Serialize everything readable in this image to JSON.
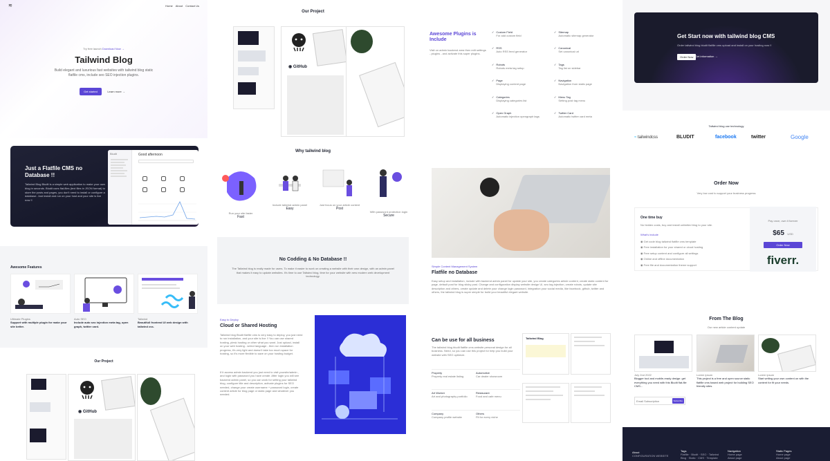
{
  "p1": {
    "nav": [
      "Home",
      "About",
      "Contact Us"
    ],
    "tagline_left": "Try free launch",
    "tagline_btn": "Download Now →",
    "title": "Tailwind Blog",
    "desc": "Build elegant and luxurious fast websites with tailwind blog static flatfile cms, include seo SEO injection plugins.",
    "cta_primary": "Get started",
    "cta_secondary": "Learn more →"
  },
  "p2": {
    "heading": "Just a Flatfile CMS no Database !!",
    "desc": "Tailwind Blog Bludit is a simple web application to make your own blog in seconds. Bludit uses flat-files (text files in JSON format) to store the posts and pages, you don't need to install or configure a database. Just install and run on your host and your site is live now !!",
    "dash_title": "Bludit",
    "dash_greet": "Good afternoon"
  },
  "p3": {
    "heading": "Awesome Features",
    "cards": [
      {
        "tag": "Ultimate Plugins",
        "text": "Support with multiple plugin for make your site better."
      },
      {
        "tag": "Auto SEO",
        "text": "Include auto seo injection meta tag, open graph, twitter card."
      },
      {
        "tag": "Tailwind",
        "text": "Beautifull frontend UI web design with tailwind css."
      }
    ]
  },
  "p4": {
    "heading": "Our Project"
  },
  "p5": {
    "heading": "Our Project",
    "github_label": "GitHub"
  },
  "p6": {
    "heading": "Why tailwind blog",
    "items": [
      {
        "small": "Run your site faster",
        "big": "Fast"
      },
      {
        "small": "Include tailwind admin panel",
        "big": "Easy"
      },
      {
        "small": "Just focus on your article content",
        "big": "Post"
      },
      {
        "small": "With password protection login",
        "big": "Secure"
      }
    ]
  },
  "p7": {
    "heading": "No Codding & No Database !!",
    "desc": "The Tailwind blog is really made for users. To make it easier to work on creating a website with their own design, with an admin panel that makes it easy to update websites. It's time to use Tailwind blog, time for your website with new modern web development technology."
  },
  "p8": {
    "tag": "Easy to Deploy",
    "heading": "Cloud or Shared Hosting",
    "desc1": "Tailwind blog Bludit flatfile cms is very easy to deploy, you just need to run installation, and your site is live !! You can use shared hosting, plesk hosting or other what you want. Just upload, install on your web hosting - select language - then run installation progress, it's very light and doesn't take too much space for hosting, so it's more flexible to save on your hosting budget.",
    "desc2": "If it access admin backend you just need to visit yoursite/admin , and login with password you have create. After login you will see backend admin panel, so you can work for setting your tailwind blog, configure title and description, activate plugins for SEO needed, change your create username + password login, create content article for blog page or static page and whatever you needed."
  },
  "p9": {
    "heading": "Awesome Plugins is Include",
    "desc": "Visit on admin backend area then edit settings - plugins - and activate this super plugins.",
    "plugins": [
      {
        "name": "Custom Field",
        "desc": "For add custom field"
      },
      {
        "name": "Sitemap",
        "desc": "Automatic sitemap generator"
      },
      {
        "name": "RSS",
        "desc": "Auto RSS feed generator"
      },
      {
        "name": "Canonical",
        "desc": "Set canonical url"
      },
      {
        "name": "Robots",
        "desc": "Robots meta tag setup"
      },
      {
        "name": "Tags",
        "desc": "Tag list on sidebar"
      },
      {
        "name": "Page",
        "desc": "Displaying content page"
      },
      {
        "name": "Navigation",
        "desc": "Navigation from static page"
      },
      {
        "name": "Categories",
        "desc": "Displaying categories list"
      },
      {
        "name": "Menu Tag",
        "desc": "Setting post tag menu"
      },
      {
        "name": "Open Graph",
        "desc": "Automatic injection opengraph tags"
      },
      {
        "name": "Twitter Card",
        "desc": "Automatic twitter card meta"
      }
    ]
  },
  "p10": {
    "tag": "Simple Content Management System",
    "heading": "Flatfile no Database",
    "desc": "Easy setup and installation, include with backend admin panel for update your site, you create categories article content, create static content for page, default post for blog sticky post. Change and configuration display website design UI, seo tag injection, create robots, update site description and others, create update and delete your change login password, integration your social media, like facebook, github, twitter and others, the tailwind blog is super simple for build your beautiful elegant website."
  },
  "p11": {
    "heading": "Can be use for all business",
    "desc": "The tailwind blog bludit flatfile cms website personal design for all business. Need, so you can use this project for help you build your website with SEO optimize.",
    "items": [
      {
        "name": "Property",
        "desc": "Property real estate listing"
      },
      {
        "name": "Automotive",
        "desc": "Car dealer showroom"
      },
      {
        "name": "Art Worker",
        "desc": "Art and photography portfolio"
      },
      {
        "name": "Restaurant",
        "desc": "Food and cafe menu"
      },
      {
        "name": "Company",
        "desc": "Company profile website"
      },
      {
        "name": "Others",
        "desc": "Fit for every niche"
      }
    ],
    "shot_logo": "Tailwind Blog"
  },
  "p12": {
    "heading": "Get Start now with tailwind blog CMS",
    "desc": "Order tailwind blog bludit flatfile cms upload and install on your hosting now !!",
    "btn_primary": "Order Now",
    "btn_secondary": "Get information →"
  },
  "p13": {
    "heading": "Tailwind blog use technology",
    "logos": [
      "tailwindcss",
      "BLUDIT",
      "facebook",
      "twitter",
      "Google"
    ]
  },
  "p14": {
    "heading": "Order Now",
    "subheading": "Very low cost to support your business progress",
    "plan_title": "One time buy",
    "plan_desc": "No hidden costs, buy and install unlimited blog to your site.",
    "includes_label": "What's include",
    "features": [
      "Get code blog tailwind flatfile cms template",
      "Free installation for your shared or cloud hosting",
      "Free setup content and configure all settings",
      "Online and offline documentation",
      "Free file and documentation theme support"
    ],
    "pay_label": "Pay once, own it forever",
    "price": "$65",
    "price_unit": "USD",
    "btn": "Order Now",
    "marketplace": "fiverr."
  },
  "p15": {
    "heading": "From The Blog",
    "subheading": "Our new article content update",
    "posts": [
      {
        "date": "July 2nd 2022",
        "title": "Blogger tool and mobile-ready design: get everything you need with this Bludit flat-file CMS..."
      },
      {
        "date": "Lorem ipsum",
        "title": "This project is a free and open source static flatfile cms based web project for building SEO friendly sites."
      },
      {
        "date": "Lorem ipsum",
        "title": "Start writing your own content on with the content for fit your needs."
      }
    ],
    "newsletter_placeholder": "Email Subscription",
    "newsletter_btn": "Subscribe"
  },
  "p16": {
    "cols": [
      {
        "title": "About",
        "lines": [
          "CONFIGURATION WEBSITE"
        ]
      },
      {
        "title": "Tags",
        "lines": [
          "Flatfile · Bludit · SEO · Tailwind",
          "Blog · Static · CMS · Template"
        ]
      },
      {
        "title": "Navigation",
        "lines": [
          "Home page",
          "About page"
        ]
      },
      {
        "title": "Static Pages",
        "lines": [
          "Home page",
          "About page"
        ]
      }
    ]
  },
  "colors": {
    "accent": "#5b46d6",
    "dark": "#1b1b2e",
    "footer": "#1a1d33",
    "fiverr": "#1dbf73"
  }
}
